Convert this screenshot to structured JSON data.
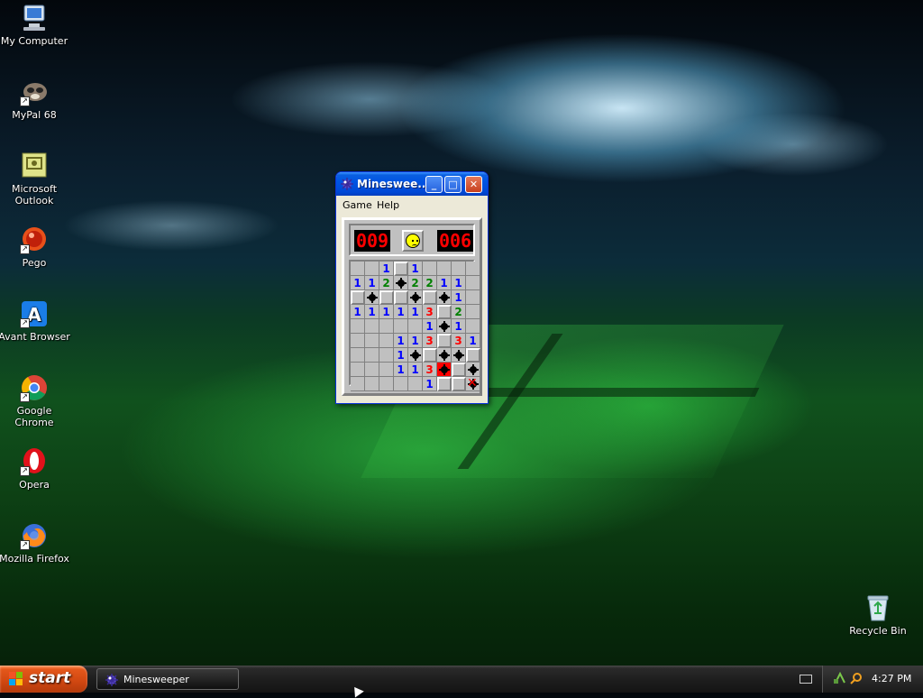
{
  "desktop": {
    "icons": [
      {
        "label": "My Computer",
        "icon": "computer-icon"
      },
      {
        "label": "MyPal 68",
        "icon": "mypal-icon"
      },
      {
        "label": "Microsoft Outlook",
        "icon": "outlook-icon"
      },
      {
        "label": "Pego",
        "icon": "pego-icon"
      },
      {
        "label": "Avant Browser",
        "icon": "avant-browser-icon"
      },
      {
        "label": "Google Chrome",
        "icon": "chrome-icon"
      },
      {
        "label": "Opera",
        "icon": "opera-icon"
      },
      {
        "label": "Mozilla Firefox",
        "icon": "firefox-icon"
      },
      {
        "label": "Recycle Bin",
        "icon": "recycle-bin-icon"
      }
    ]
  },
  "window": {
    "title": "Mineswee...",
    "menu": [
      "Game",
      "Help"
    ],
    "mine_counter": "009",
    "timer": "006",
    "face": "sad",
    "board": {
      "rows": 9,
      "cols": 9,
      "legend": "c=covered, o=open empty, 1-8=number, m=revealed mine, x=exploded mine, w=wrong flag",
      "cells": [
        [
          "o",
          "o",
          "1",
          "c",
          "1",
          "o",
          "o",
          "o",
          "o"
        ],
        [
          "1",
          "1",
          "2",
          "m",
          "2",
          "2",
          "1",
          "1",
          "o"
        ],
        [
          "c",
          "m",
          "c",
          "c",
          "m",
          "c",
          "m",
          "1",
          "o"
        ],
        [
          "1",
          "1",
          "1",
          "1",
          "1",
          "3",
          "c",
          "2",
          "o"
        ],
        [
          "o",
          "o",
          "o",
          "o",
          "o",
          "1",
          "m",
          "1",
          "o"
        ],
        [
          "o",
          "o",
          "o",
          "1",
          "1",
          "3",
          "c",
          "3",
          "1"
        ],
        [
          "o",
          "o",
          "o",
          "1",
          "m",
          "c",
          "m",
          "m",
          "c"
        ],
        [
          "o",
          "o",
          "o",
          "1",
          "1",
          "3",
          "x",
          "c",
          "m"
        ],
        [
          "o",
          "o",
          "o",
          "o",
          "o",
          "1",
          "c",
          "c",
          "w"
        ]
      ]
    }
  },
  "taskbar": {
    "start_label": "start",
    "tasks": [
      {
        "label": "Minesweeper",
        "icon": "minesweeper-icon"
      }
    ],
    "clock": "4:27 PM"
  },
  "colors": {
    "title_blue": "#0054e3",
    "number_1": "#0000ff",
    "number_2": "#008000",
    "number_3": "#ff0000",
    "lcd_red": "#ff0000"
  }
}
